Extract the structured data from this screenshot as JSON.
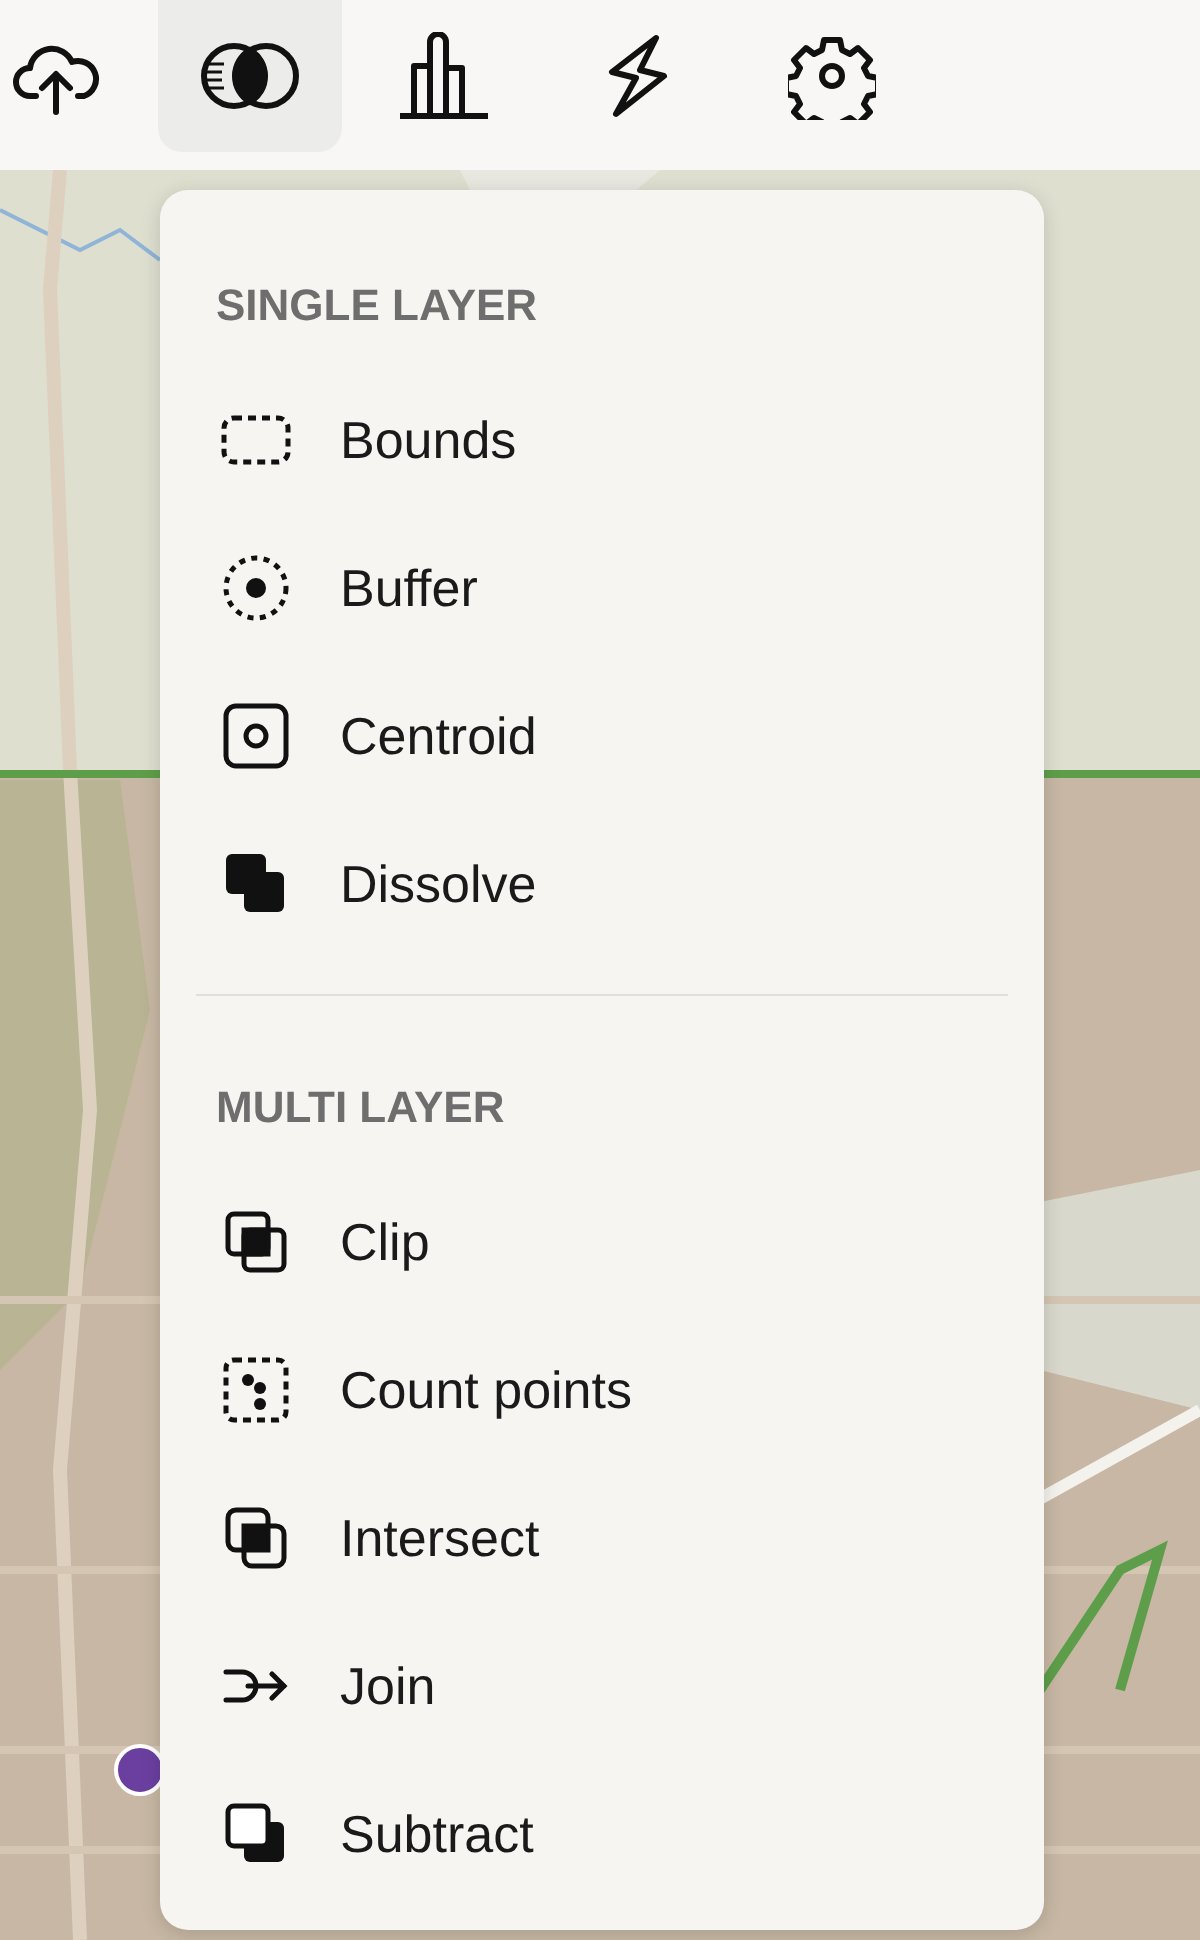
{
  "toolbar": [
    {
      "kind": "upload",
      "selected": false
    },
    {
      "kind": "overlay",
      "selected": true
    },
    {
      "kind": "chart",
      "selected": false
    },
    {
      "kind": "bolt",
      "selected": false
    },
    {
      "kind": "gear",
      "selected": false
    }
  ],
  "menu": {
    "sections": [
      {
        "title": "SINGLE LAYER",
        "items": [
          {
            "label": "Bounds",
            "kind": "bounds"
          },
          {
            "label": "Buffer",
            "kind": "buffer"
          },
          {
            "label": "Centroid",
            "kind": "centroid"
          },
          {
            "label": "Dissolve",
            "kind": "dissolve"
          }
        ]
      },
      {
        "title": "MULTI LAYER",
        "items": [
          {
            "label": "Clip",
            "kind": "clip"
          },
          {
            "label": "Count points",
            "kind": "count"
          },
          {
            "label": "Intersect",
            "kind": "intersect"
          },
          {
            "label": "Join",
            "kind": "join"
          },
          {
            "label": "Subtract",
            "kind": "subtract"
          }
        ]
      }
    ]
  }
}
